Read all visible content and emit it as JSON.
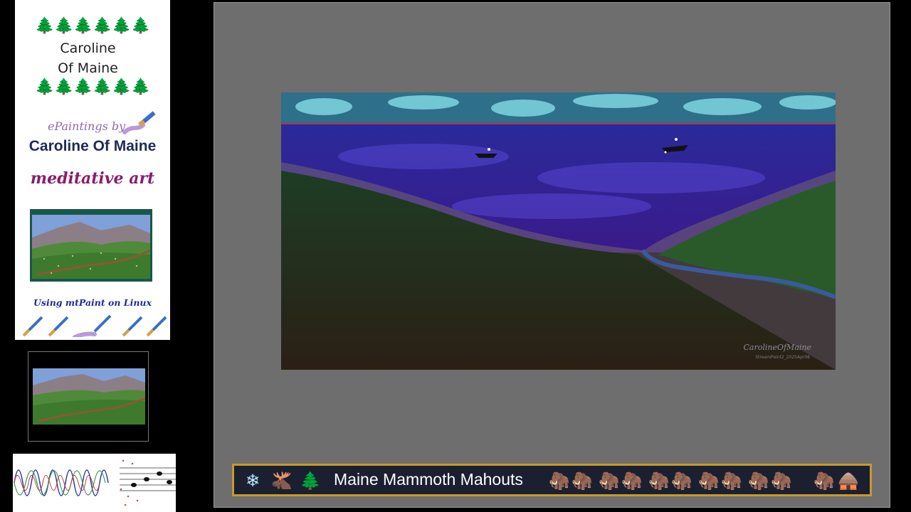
{
  "brand": {
    "title_line1": "Caroline",
    "title_line2": "Of Maine",
    "epaintings_label": "ePaintings by",
    "artist_name": "Caroline Of Maine",
    "tagline": "meditative art",
    "using_text": "Using mtPaint on Linux",
    "tree_icon": "evergreen-tree-icon",
    "brush_icon": "paintbrush-icon"
  },
  "painting": {
    "signature": "CarolineOfMaine",
    "subtext": "StreamPaint2_2025Apr08"
  },
  "ticker": {
    "icons": [
      "snowflake-icon",
      "moose-icon",
      "tree-icon"
    ],
    "title": "Maine Mammoth Mahouts",
    "mammoth_icon": "mammoth-icon",
    "end_icon": "hut-icon"
  },
  "colors": {
    "canvas_bg": "#6e6e6e",
    "ticker_border": "#c79b2a",
    "ticker_bg": "#1a2030",
    "artist_color": "#1e2a5a",
    "tagline_color": "#8a1d6b"
  }
}
